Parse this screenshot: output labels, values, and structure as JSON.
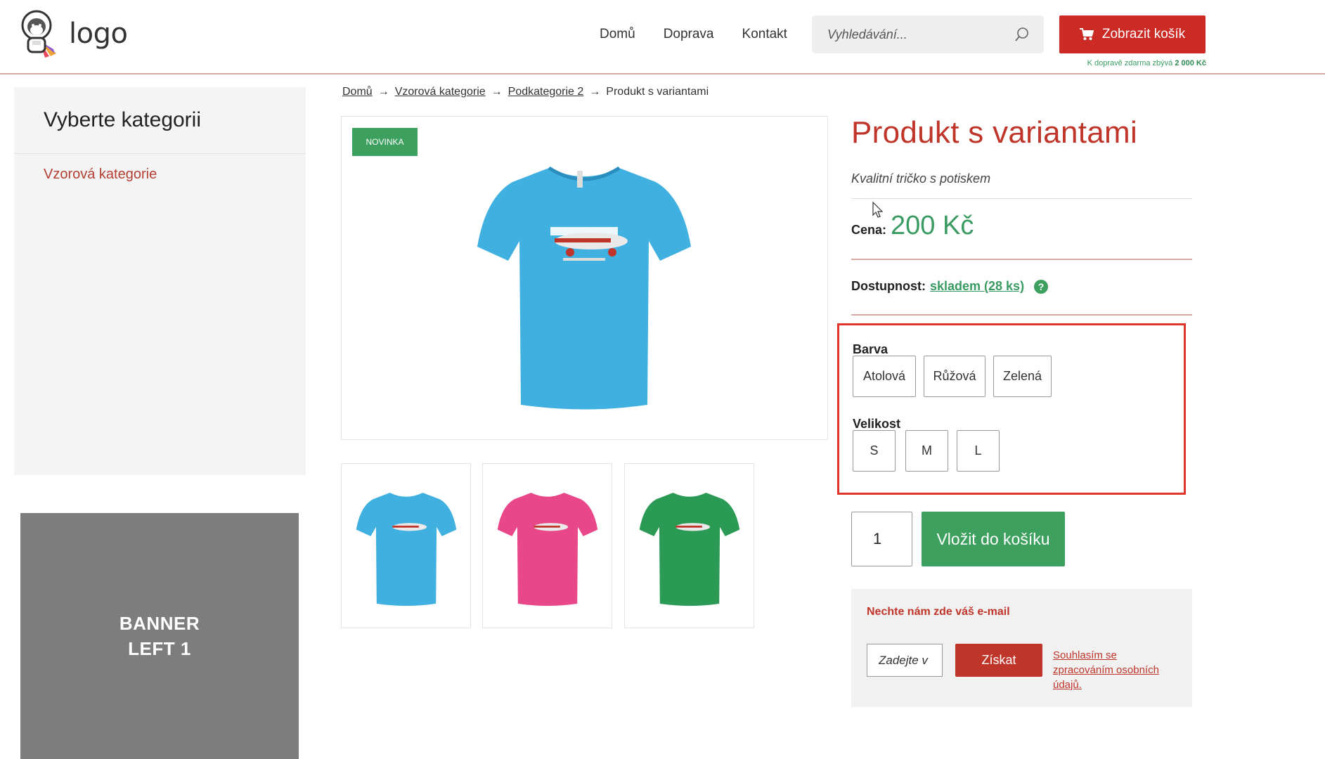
{
  "header": {
    "logo_text": "logo",
    "nav": [
      "Domů",
      "Doprava",
      "Kontakt"
    ],
    "search_placeholder": "Vyhledávání...",
    "cart_label": "Zobrazit košík",
    "shipping_note_prefix": "K dopravě zdarma zbývá ",
    "shipping_note_amount": "2 000 Kč"
  },
  "sidebar": {
    "title": "Vyberte kategorii",
    "items": [
      "Vzorová kategorie"
    ],
    "banner_line1": "BANNER",
    "banner_line2": "LEFT 1"
  },
  "breadcrumb": {
    "items": [
      "Domů",
      "Vzorová kategorie",
      "Podkategorie 2"
    ],
    "current": "Produkt s variantami"
  },
  "gallery": {
    "badge": "NOVINKA",
    "main_color": "#3fb0e0",
    "thumb_colors": [
      "#3fb0e0",
      "#e8488a",
      "#2b9a55"
    ]
  },
  "product": {
    "title": "Produkt s variantami",
    "subtitle": "Kvalitní tričko s potiskem",
    "price_label": "Cena:",
    "price_value": "200 Kč",
    "availability_label": "Dostupnost:",
    "availability_value": "skladem (28 ks)",
    "help": "?",
    "variant_color_label": "Barva",
    "colors": [
      "Atolová",
      "Růžová",
      "Zelená"
    ],
    "variant_size_label": "Velikost",
    "sizes": [
      "S",
      "M",
      "L"
    ],
    "quantity": "1",
    "add_to_cart": "Vložit do košíku"
  },
  "newsletter": {
    "title": "Nechte nám zde váš e-mail",
    "placeholder": "Zadejte v",
    "button": "Získat",
    "consent": "Souhlasím se zpracováním osobních údajů."
  }
}
